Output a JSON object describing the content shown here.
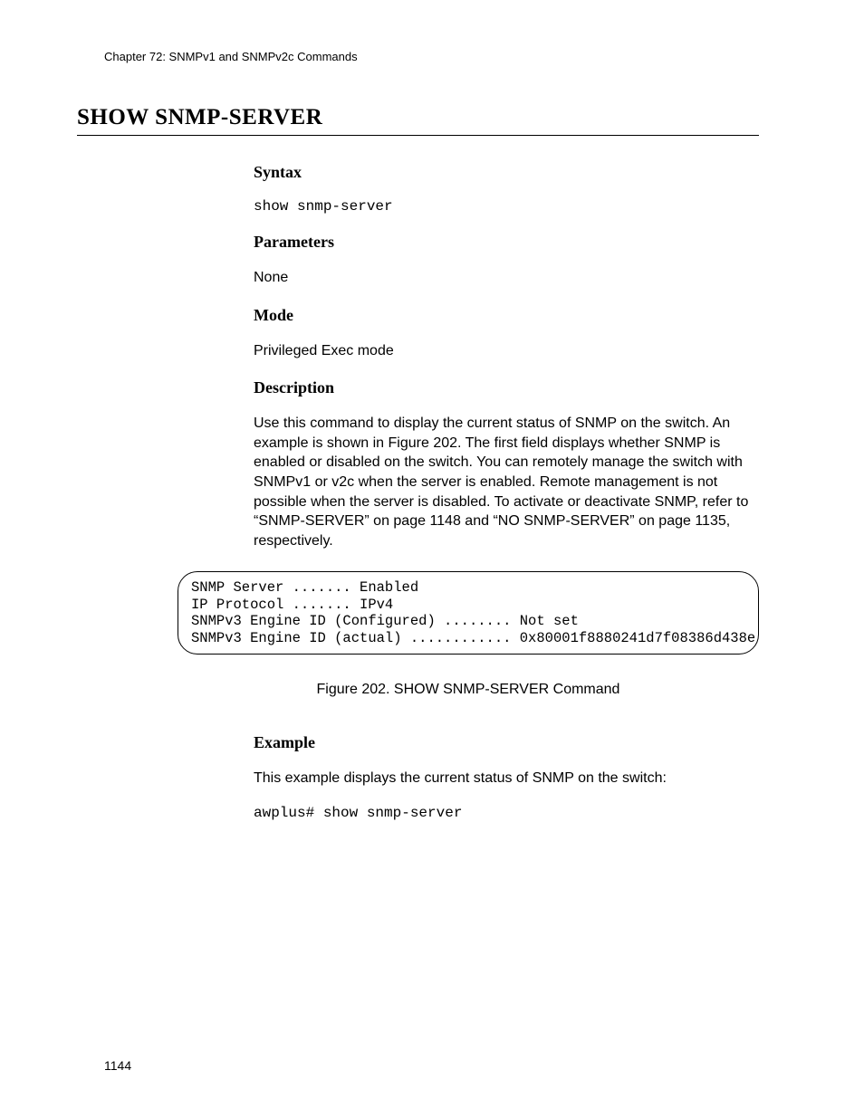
{
  "header": {
    "chapter": "Chapter 72: SNMPv1 and SNMPv2c Commands"
  },
  "title": "SHOW SNMP-SERVER",
  "sections": {
    "syntax": {
      "heading": "Syntax",
      "command": "show snmp-server"
    },
    "parameters": {
      "heading": "Parameters",
      "text": "None"
    },
    "mode": {
      "heading": "Mode",
      "text": "Privileged Exec mode"
    },
    "description": {
      "heading": "Description",
      "text": "Use this command to display the current status of SNMP on the switch. An example is shown in Figure 202. The first field displays whether SNMP is enabled or disabled on the switch. You can remotely manage the switch with SNMPv1 or v2c when the server is enabled. Remote management is not possible when the server is disabled. To activate or deactivate SNMP, refer to “SNMP-SERVER” on page 1148 and “NO SNMP-SERVER” on page 1135, respectively."
    },
    "figure": {
      "content": "SNMP Server ....... Enabled\nIP Protocol ....... IPv4\nSNMPv3 Engine ID (Configured) ........ Not set\nSNMPv3 Engine ID (actual) ............ 0x80001f8880241d7f08386d438e",
      "caption": "Figure 202. SHOW SNMP-SERVER Command"
    },
    "example": {
      "heading": "Example",
      "text": "This example displays the current status of SNMP on the switch:",
      "command": "awplus# show snmp-server"
    }
  },
  "page_number": "1144"
}
